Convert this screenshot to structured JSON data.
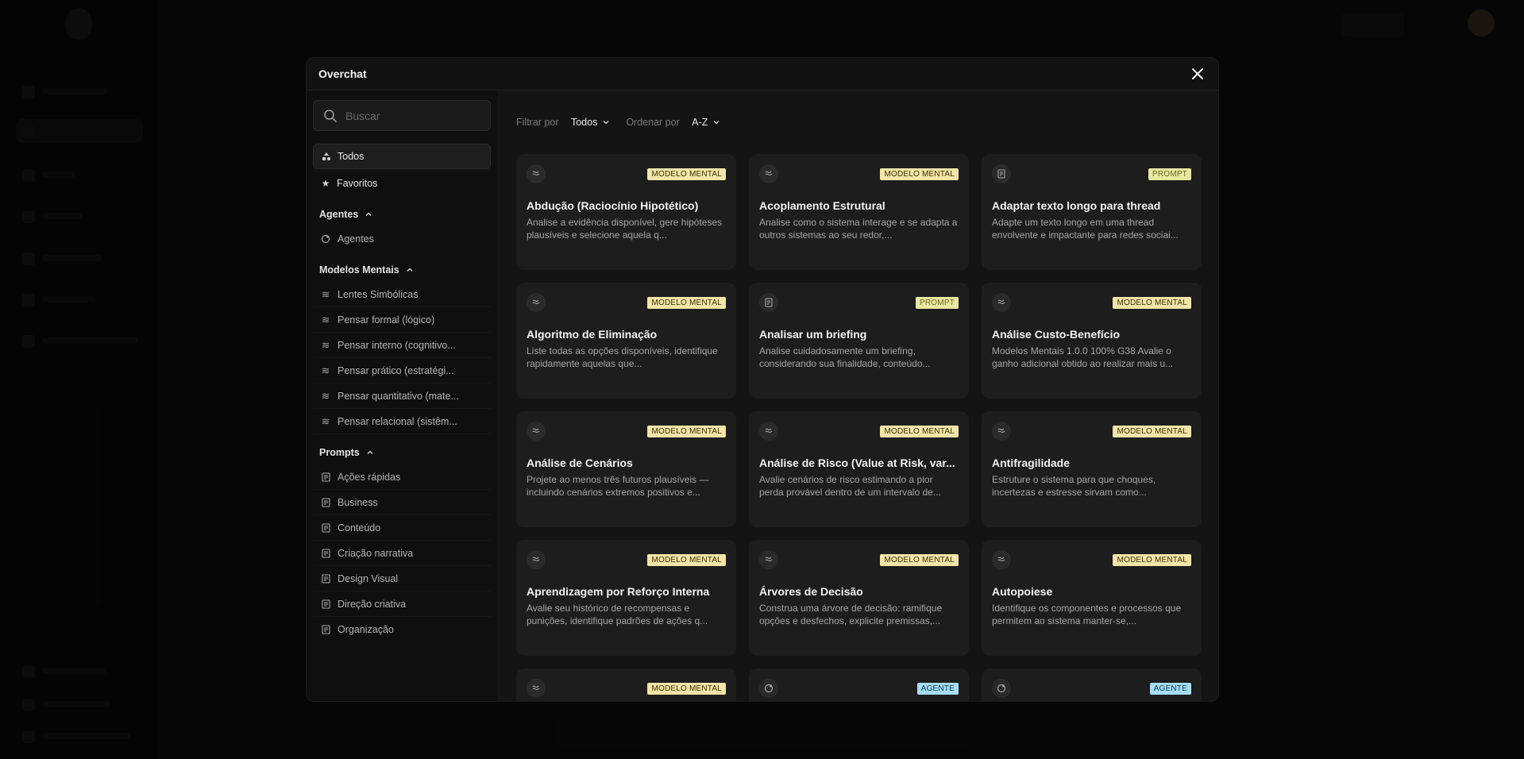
{
  "modal": {
    "title": "Overchat"
  },
  "search": {
    "placeholder": "Buscar"
  },
  "nav": {
    "todos": "Todos",
    "favoritos": "Favoritos"
  },
  "sections": {
    "agentes": {
      "label": "Agentes",
      "items": [
        "Agentes"
      ]
    },
    "modelos": {
      "label": "Modelos Mentais",
      "items": [
        "Lentes Simbólicas",
        "Pensar formal (lógico)",
        "Pensar interno (cognitivo...",
        "Pensar prático (estratégi...",
        "Pensar quantitativo (mate...",
        "Pensar relacional (sistêm..."
      ]
    },
    "prompts": {
      "label": "Prompts",
      "items": [
        "Ações rápidas",
        "Business",
        "Conteúdo",
        "Criação narrativa",
        "Design Visual",
        "Direção criativa",
        "Organização"
      ]
    }
  },
  "filters": {
    "filter_label": "Filtrar por",
    "filter_value": "Todos",
    "sort_label": "Ordenar por",
    "sort_value": "A-Z"
  },
  "cards": [
    {
      "icon": "mental-model-icon",
      "badge": "MODELO MENTAL",
      "title": "Abdução (Raciocínio Hipotético)",
      "desc": "Analise a evidência disponível, gere hipóteses plausíveis e selecione aquela q..."
    },
    {
      "icon": "mental-model-icon",
      "badge": "MODELO MENTAL",
      "title": "Acoplamento Estrutural",
      "desc": "Analise como o sistema interage e se adapta a outros sistemas ao seu redor,..."
    },
    {
      "icon": "prompt-icon",
      "badge": "PROMPT",
      "title": "Adaptar texto longo para thread",
      "desc": "Adapte um texto longo em uma thread envolvente e impactante para redes sociai..."
    },
    {
      "icon": "mental-model-icon",
      "badge": "MODELO MENTAL",
      "title": "Algoritmo de Eliminação",
      "desc": "Liste todas as opções disponíveis, identifique rapidamente aquelas que..."
    },
    {
      "icon": "prompt-icon",
      "badge": "PROMPT",
      "title": "Analisar um briefing",
      "desc": "Analise cuidadosamente um briefing, considerando sua finalidade, conteúdo..."
    },
    {
      "icon": "mental-model-icon",
      "badge": "MODELO MENTAL",
      "title": "Análise Custo-Benefício",
      "desc": "Modelos Mentais 1.0.0 100% G38 Avalie o ganho adicional obtido ao realizar mais u..."
    },
    {
      "icon": "mental-model-icon",
      "badge": "MODELO MENTAL",
      "title": "Análise de Cenários",
      "desc": "Projete ao menos três futuros plausíveis — incluindo cenários extremos positivos e..."
    },
    {
      "icon": "mental-model-icon",
      "badge": "MODELO MENTAL",
      "title": "Análise de Risco (Value at Risk, var...",
      "desc": "Avalie cenários de risco estimando a pior perda provável dentro de um intervalo de..."
    },
    {
      "icon": "mental-model-icon",
      "badge": "MODELO MENTAL",
      "title": "Antifragilidade",
      "desc": "Estruture o sistema para que choques, incertezas e estresse sirvam como..."
    },
    {
      "icon": "mental-model-icon",
      "badge": "MODELO MENTAL",
      "title": "Aprendizagem por Reforço Interna",
      "desc": "Avalie seu histórico de recompensas e punições, identifique padrões de ações q..."
    },
    {
      "icon": "mental-model-icon",
      "badge": "MODELO MENTAL",
      "title": "Árvores de Decisão",
      "desc": "Construa uma árvore de decisão: ramifique opções e desfechos, explicite premissas,..."
    },
    {
      "icon": "mental-model-icon",
      "badge": "MODELO MENTAL",
      "title": "Autopoiese",
      "desc": "Identifique os componentes e processos que permitem ao sistema manter-se,..."
    },
    {
      "icon": "mental-model-icon",
      "badge": "MODELO MENTAL",
      "title": "",
      "desc": ""
    },
    {
      "icon": "agent-icon",
      "badge": "AGENTE",
      "title": "",
      "desc": ""
    },
    {
      "icon": "agent-icon",
      "badge": "AGENTE",
      "title": "",
      "desc": ""
    }
  ]
}
